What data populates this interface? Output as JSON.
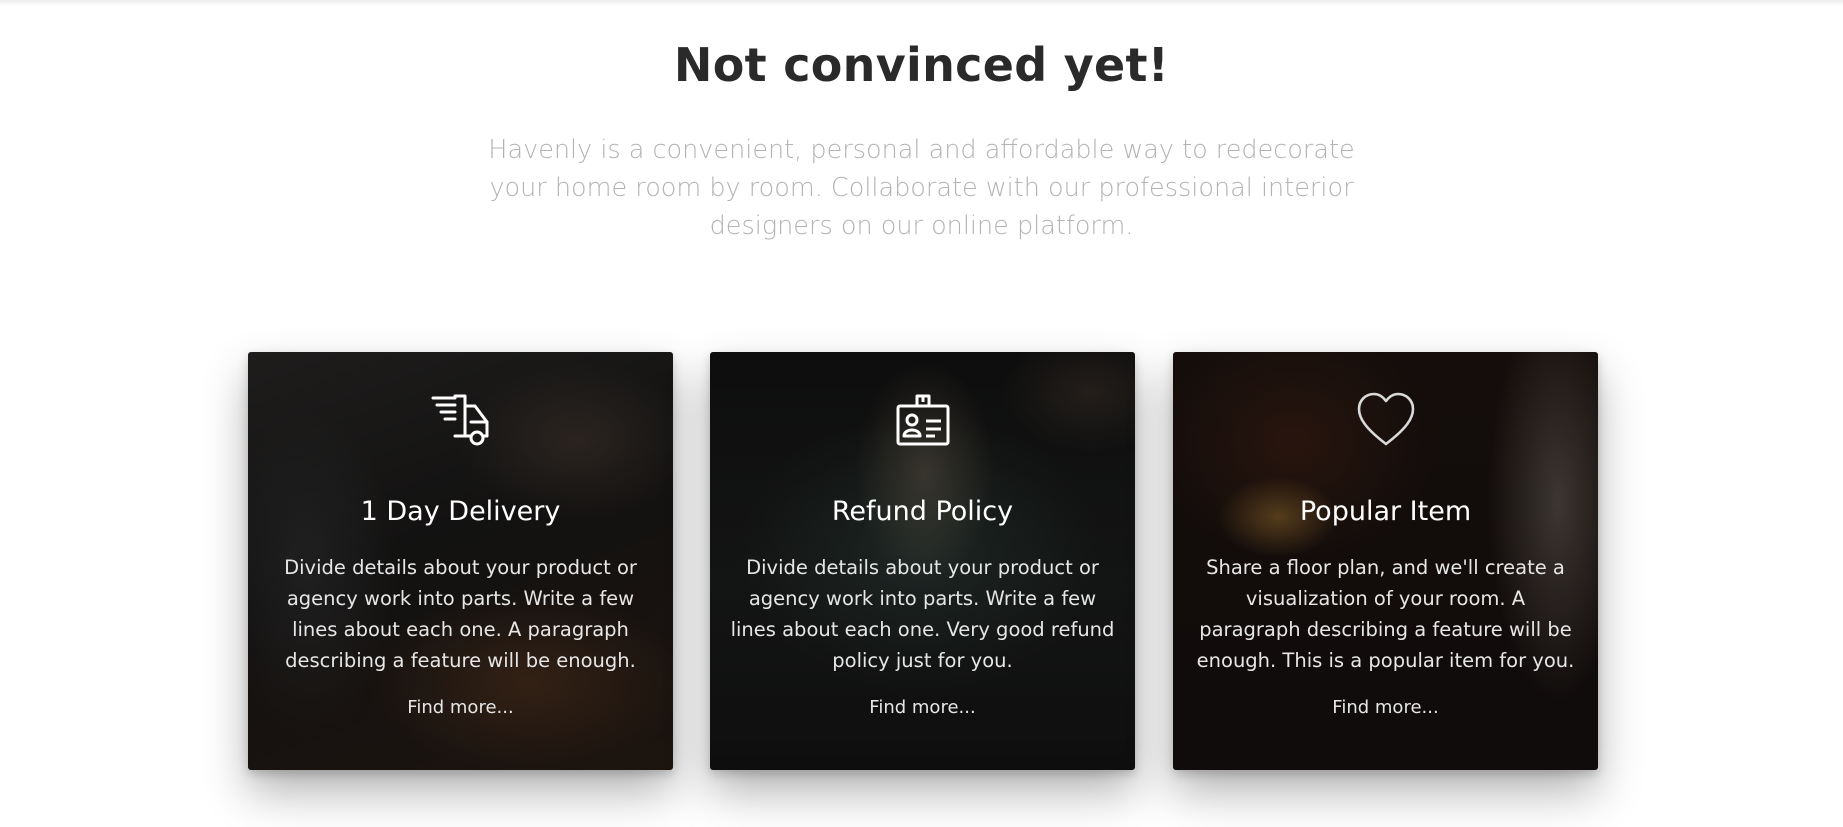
{
  "section": {
    "heading": "Not convinced yet!",
    "intro": "Havenly is a convenient, personal and affordable way to redecorate your home room by room. Collaborate with our professional interior designers on our online platform."
  },
  "cards": [
    {
      "icon": "delivery-truck-icon",
      "title": "1 Day Delivery",
      "text": "Divide details about your product or agency work into parts. Write a few lines about each one. A paragraph describing a feature will be enough.",
      "link": "Find more..."
    },
    {
      "icon": "id-badge-icon",
      "title": "Refund Policy",
      "text": "Divide details about your product or agency work into parts. Write a few lines about each one. Very good refund policy just for you.",
      "link": "Find more..."
    },
    {
      "icon": "heart-icon",
      "title": "Popular Item",
      "text": "Share a floor plan, and we'll create a visualization of your room. A paragraph describing a feature will be enough. This is a popular item for you.",
      "link": "Find more..."
    }
  ],
  "colors": {
    "heading": "#2a2a2a",
    "intro": "#b3b3b3",
    "card_text": "#ffffff"
  }
}
